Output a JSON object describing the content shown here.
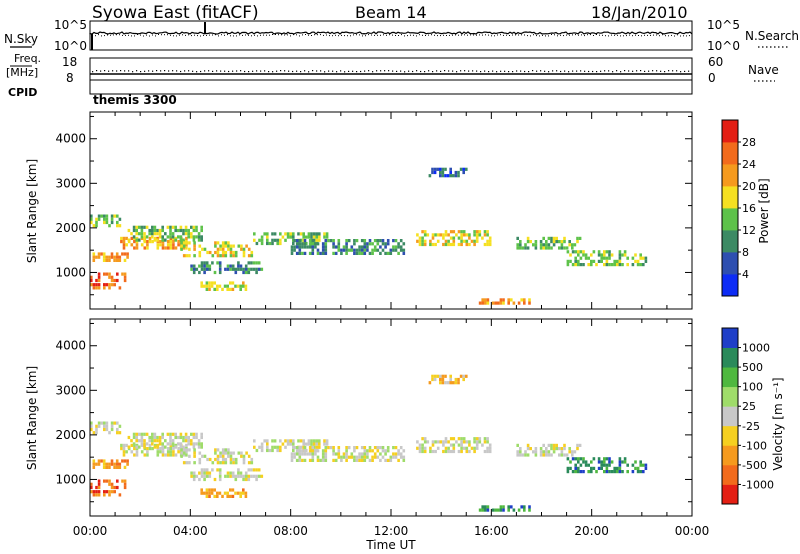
{
  "header": {
    "station": "Syowa East (fitACF)",
    "beam": "Beam 14",
    "date": "18/Jan/2010"
  },
  "top_panels": {
    "nsky": {
      "label": "N.Sky",
      "right_label": "N.Search",
      "ticks_left": [
        "10^5",
        "10^0"
      ],
      "ticks_right": [
        "10^5",
        "10^0"
      ]
    },
    "freq": {
      "label_line1": "Freq.",
      "label_line2": "[MHz]",
      "right_label": "Nave",
      "ticks_left": [
        "18",
        "8"
      ],
      "ticks_right": [
        "60",
        "0"
      ]
    },
    "cpid": {
      "label": "CPID",
      "value": "themis 3300"
    }
  },
  "chart_data": [
    {
      "type": "heatmap",
      "quantity": "Power",
      "xlabel": "",
      "ylabel": "Slant Range [km]",
      "x_ticks": [
        "00:00",
        "04:00",
        "08:00",
        "12:00",
        "16:00",
        "20:00",
        "00:00"
      ],
      "y_ticks": [
        1000,
        2000,
        3000,
        4000
      ],
      "ylim": [
        180,
        4600
      ],
      "xlim_hours": [
        0,
        24
      ],
      "colorbar": {
        "label": "Power [dB]",
        "tick_labels": [
          "4",
          "8",
          "12",
          "16",
          "20",
          "24",
          "28"
        ],
        "colors": [
          "#0d2cf5",
          "#2e4fb0",
          "#3c8a64",
          "#5ec24a",
          "#f5e021",
          "#f59a1e",
          "#f26b1c",
          "#e41f14"
        ]
      },
      "echo_bands": [
        {
          "t0": 0.0,
          "t1": 1.2,
          "r0": 2050,
          "r1": 2300,
          "level": 3
        },
        {
          "t0": 0.1,
          "t1": 1.5,
          "r0": 1250,
          "r1": 1450,
          "level": 5
        },
        {
          "t0": 0.0,
          "t1": 1.4,
          "r0": 850,
          "r1": 1000,
          "level": 6
        },
        {
          "t0": 0.0,
          "t1": 1.3,
          "r0": 640,
          "r1": 760,
          "level": 6
        },
        {
          "t0": 1.2,
          "t1": 3.8,
          "r0": 1550,
          "r1": 1800,
          "level": 5
        },
        {
          "t0": 1.5,
          "t1": 4.5,
          "r0": 1750,
          "r1": 2050,
          "level": 3
        },
        {
          "t0": 3.6,
          "t1": 6.5,
          "r0": 1400,
          "r1": 1700,
          "level": 4
        },
        {
          "t0": 4.0,
          "t1": 6.8,
          "r0": 1000,
          "r1": 1250,
          "level": 2
        },
        {
          "t0": 4.4,
          "t1": 6.2,
          "r0": 600,
          "r1": 800,
          "level": 4
        },
        {
          "t0": 6.5,
          "t1": 9.5,
          "r0": 1650,
          "r1": 1900,
          "level": 3
        },
        {
          "t0": 8.0,
          "t1": 12.5,
          "r0": 1450,
          "r1": 1750,
          "level": 2
        },
        {
          "t0": 13.0,
          "t1": 16.0,
          "r0": 1650,
          "r1": 1950,
          "level": 4
        },
        {
          "t0": 15.5,
          "t1": 17.5,
          "r0": 300,
          "r1": 420,
          "level": 5
        },
        {
          "t0": 17.0,
          "t1": 19.5,
          "r0": 1550,
          "r1": 1800,
          "level": 3
        },
        {
          "t0": 19.0,
          "t1": 22.2,
          "r0": 1150,
          "r1": 1500,
          "level": 3
        },
        {
          "t0": 13.5,
          "t1": 15.0,
          "r0": 3200,
          "r1": 3350,
          "level": 1
        }
      ]
    },
    {
      "type": "heatmap",
      "quantity": "Velocity",
      "xlabel": "Time UT",
      "ylabel": "Slant Range [km]",
      "x_ticks": [
        "00:00",
        "04:00",
        "08:00",
        "12:00",
        "16:00",
        "20:00",
        "00:00"
      ],
      "y_ticks": [
        1000,
        2000,
        3000,
        4000
      ],
      "ylim": [
        180,
        4600
      ],
      "xlim_hours": [
        0,
        24
      ],
      "colorbar": {
        "label": "Velocity [m s⁻¹]",
        "tick_labels": [
          "1000",
          "500",
          "100",
          "25",
          "-25",
          "-100",
          "-500",
          "-1000"
        ],
        "colors": [
          "#1f3fc8",
          "#2a8a5a",
          "#4fb83f",
          "#9fdc6a",
          "#c8c8c8",
          "#f5d020",
          "#f59a1e",
          "#f26b1c",
          "#e41f14"
        ]
      },
      "echo_bands": [
        {
          "t0": 0.0,
          "t1": 1.2,
          "r0": 2050,
          "r1": 2300,
          "level": 4
        },
        {
          "t0": 0.1,
          "t1": 1.5,
          "r0": 1250,
          "r1": 1450,
          "level": 6
        },
        {
          "t0": 0.0,
          "t1": 1.4,
          "r0": 850,
          "r1": 1000,
          "level": 7
        },
        {
          "t0": 0.0,
          "t1": 1.3,
          "r0": 640,
          "r1": 760,
          "level": 7
        },
        {
          "t0": 1.2,
          "t1": 3.8,
          "r0": 1550,
          "r1": 1800,
          "level": 4
        },
        {
          "t0": 1.5,
          "t1": 4.5,
          "r0": 1750,
          "r1": 2050,
          "level": 4
        },
        {
          "t0": 3.6,
          "t1": 6.5,
          "r0": 1400,
          "r1": 1700,
          "level": 4
        },
        {
          "t0": 4.0,
          "t1": 6.8,
          "r0": 1000,
          "r1": 1250,
          "level": 4
        },
        {
          "t0": 4.4,
          "t1": 6.2,
          "r0": 600,
          "r1": 800,
          "level": 6
        },
        {
          "t0": 6.5,
          "t1": 9.5,
          "r0": 1650,
          "r1": 1900,
          "level": 4
        },
        {
          "t0": 8.0,
          "t1": 12.5,
          "r0": 1450,
          "r1": 1750,
          "level": 4
        },
        {
          "t0": 13.0,
          "t1": 16.0,
          "r0": 1650,
          "r1": 1950,
          "level": 4
        },
        {
          "t0": 15.5,
          "t1": 17.5,
          "r0": 300,
          "r1": 420,
          "level": 1
        },
        {
          "t0": 17.0,
          "t1": 19.5,
          "r0": 1550,
          "r1": 1800,
          "level": 4
        },
        {
          "t0": 19.0,
          "t1": 22.2,
          "r0": 1150,
          "r1": 1500,
          "level": 1
        },
        {
          "t0": 13.5,
          "t1": 15.0,
          "r0": 3200,
          "r1": 3350,
          "level": 5
        }
      ]
    }
  ]
}
